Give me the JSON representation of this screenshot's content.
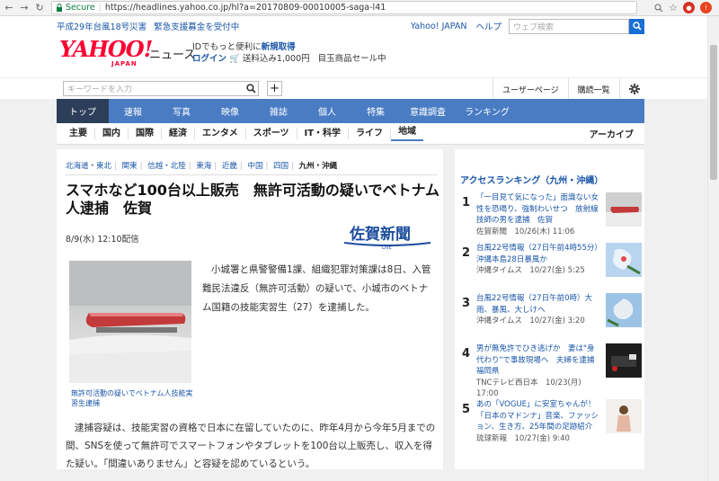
{
  "browser": {
    "secure_label": "Secure",
    "url": "https://headlines.yahoo.co.jp/hl?a=20170809-00010005-saga-l41"
  },
  "topbar": {
    "alert1": "平成29年台風18号災害",
    "alert2": "緊急支援募金を受付中",
    "yahoo_japan": "Yahoo! JAPAN",
    "help": "ヘルプ",
    "search_placeholder": "ウェブ検索"
  },
  "header": {
    "logo": "YAHOO!",
    "logo_sub": "JAPAN",
    "news": "ニュース",
    "promo_line1_pre": "IDでもっと便利に",
    "promo_line1_link": "新規取得",
    "promo_login": "ログイン",
    "promo_cart": "送料込み1,000円",
    "promo_sale": "目玉商品セール中"
  },
  "toolbar": {
    "keyword_placeholder": "キーワードを入力",
    "user_page": "ユーザーページ",
    "read_list": "購読一覧"
  },
  "main_nav": [
    "トップ",
    "速報",
    "写真",
    "映像",
    "雑誌",
    "個人",
    "特集",
    "意識調査",
    "ランキング"
  ],
  "sub_nav": [
    "主要",
    "国内",
    "国際",
    "経済",
    "エンタメ",
    "スポーツ",
    "IT・科学",
    "ライフ",
    "地域"
  ],
  "archive": "アーカイブ",
  "regions": [
    "北海道・東北",
    "関東",
    "信越・北陸",
    "東海",
    "近畿",
    "中国",
    "四国",
    "九州・沖縄"
  ],
  "article": {
    "headline": "スマホなど100台以上販売　無許可活動の疑いでベトナム人逮捕　佐賀",
    "date": "8/9(水) 12:10配信",
    "source_logo": "佐賀新聞",
    "source_logo_sub": "LIVE",
    "photo_caption": "無許可活動の疑いでベトナム人技能実習生逮捕",
    "para1": "小城署と県警警備1課、組織犯罪対策課は8日、入管難民法違反（無許可活動）の疑いで、小城市のベトナム国籍の技能実習生（27）を逮捕した。",
    "para2": "逮捕容疑は、技能実習の資格で日本に在留していたのに、昨年4月から今年5月までの間、SNSを使って無許可でスマートフォンやタブレットを100台以上販売し、収入を得た疑い。「間違いありません」と容疑を認めているという。"
  },
  "ranking": {
    "title": "アクセスランキング（九州・沖縄）",
    "items": [
      {
        "num": "1",
        "title": "「一目見て気になった」面識ない女性を恐喝り、強制わいせつ　放射線技師の男を逮捕　佐賀",
        "source": "佐賀新聞　10/26(木) 11:06"
      },
      {
        "num": "2",
        "title": "台風22号情報（27日午前4時55分）沖縄本島28日暴風か",
        "source": "沖縄タイムス　10/27(金) 5:25"
      },
      {
        "num": "3",
        "title": "台風22号情報（27日午前0時）大雨、暴風、大しけへ",
        "source": "沖縄タイムス　10/27(金) 3:20"
      },
      {
        "num": "4",
        "title": "男が無免許でひき逃げか　妻は\"身代わり\"で事故現場へ　夫婦を逮捕　福岡県",
        "source": "TNCテレビ西日本　10/23(月) 17:00"
      },
      {
        "num": "5",
        "title": "あの「VOGUE」に安室ちゃんが！「日本のマドンナ」音楽、ファッション、生き方、25年間の足跡紹介",
        "source": "琉球新報　10/27(金) 9:40"
      }
    ]
  },
  "colors": {
    "nav_blue": "#4a7cc4",
    "nav_active": "#2c3e5a",
    "link": "#1a56a8",
    "brand_red": "#ff0033"
  }
}
